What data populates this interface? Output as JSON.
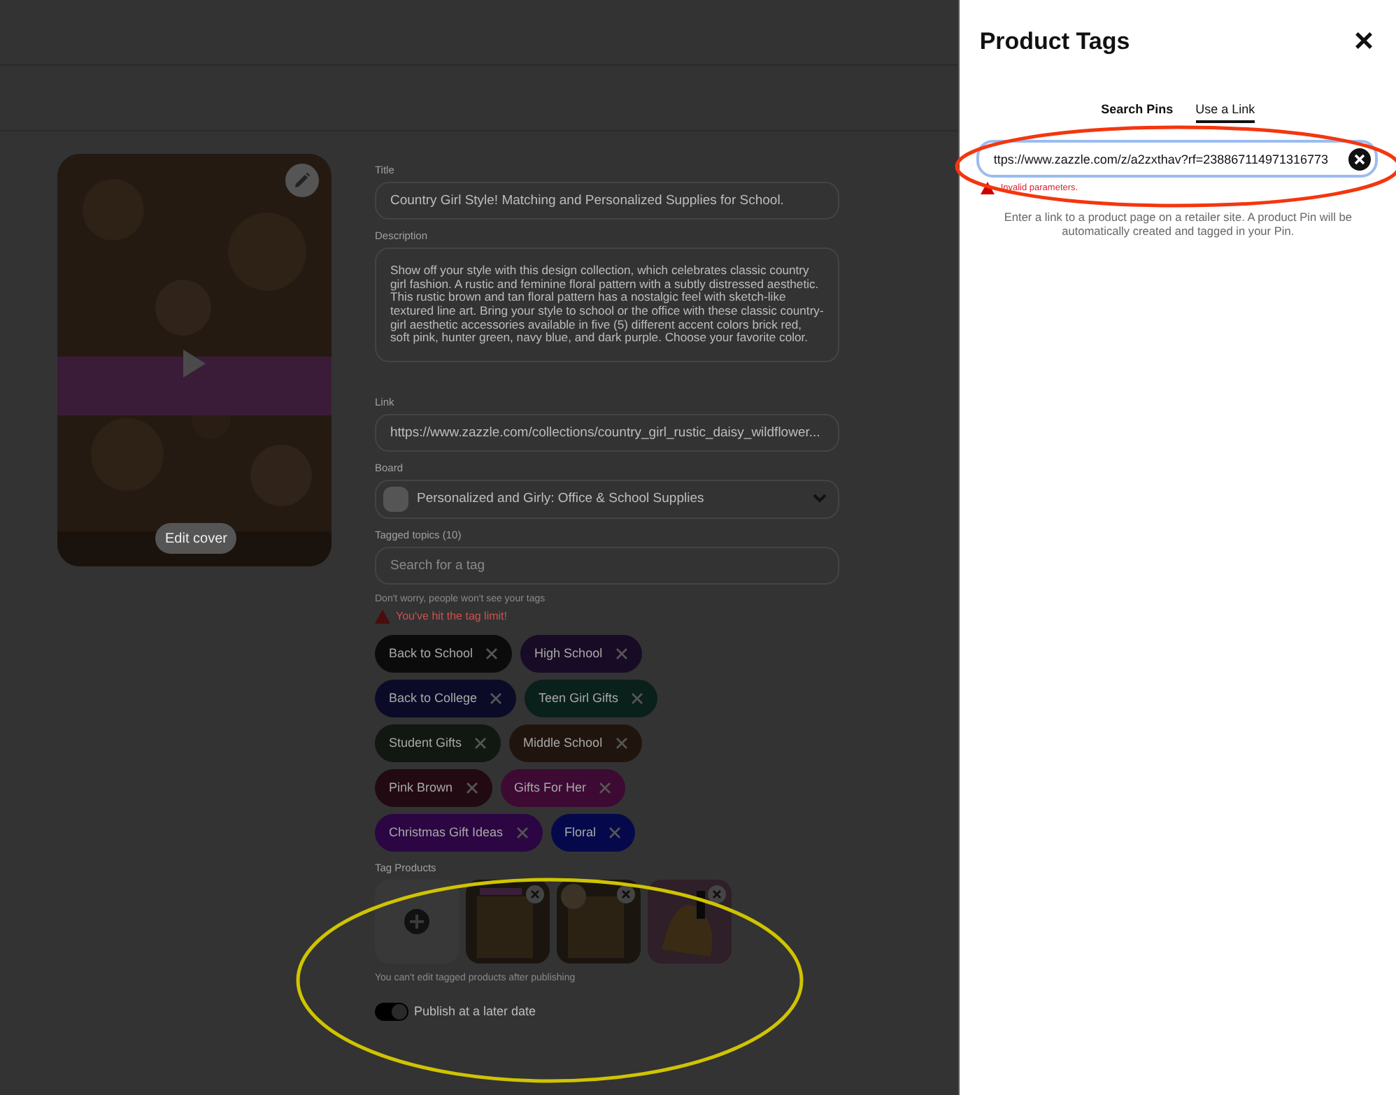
{
  "pin_form": {
    "cover": {
      "kind": "picture",
      "edit_label": "Edit cover"
    },
    "title": {
      "label": "Title",
      "value": "Country Girl Style! Matching and Personalized Supplies for School."
    },
    "description": {
      "label": "Description",
      "value": "Show off your style with this design collection, which celebrates classic country girl fashion. A rustic and feminine floral pattern with a subtly distressed aesthetic. This rustic brown and tan floral pattern has a nostalgic feel with sketch-like textured line art. Bring your style to school or the office with these classic country-girl aesthetic accessories available in five (5) different accent colors brick red, soft pink, hunter green, navy blue, and dark purple. Choose your favorite color."
    },
    "link": {
      "label": "Link",
      "value": "https://www.zazzle.com/collections/country_girl_rustic_daisy_wildflower..."
    },
    "board": {
      "label": "Board",
      "value": "Personalized and Girly: Office & School Supplies"
    },
    "topics": {
      "label": "Tagged topics (10)",
      "placeholder": "Search for a tag",
      "hint": "Don't worry, people won't see your tags",
      "error": "You've hit the tag limit!",
      "tags": [
        {
          "label": "Back to School",
          "color": "#0b0b0b"
        },
        {
          "label": "High School",
          "color": "#170b26"
        },
        {
          "label": "Back to College",
          "color": "#0b0b28"
        },
        {
          "label": "Teen Girl Gifts",
          "color": "#0a201b"
        },
        {
          "label": "Student Gifts",
          "color": "#111711"
        },
        {
          "label": "Middle School",
          "color": "#20150e"
        },
        {
          "label": "Pink Brown",
          "color": "#220a12"
        },
        {
          "label": "Gifts For Her",
          "color": "#3c0a32"
        },
        {
          "label": "Christmas Gift Ideas",
          "color": "#2b0642"
        },
        {
          "label": "Floral",
          "color": "#05094c"
        }
      ]
    },
    "products": {
      "label": "Tag Products",
      "note": "You can't edit tagged products after publishing"
    },
    "schedule": {
      "label": "Publish at a later date",
      "on": true
    }
  },
  "panel": {
    "title": "Product Tags",
    "close": "×",
    "tabs": [
      {
        "label": "Search Pins",
        "selected": false
      },
      {
        "label": "Use a Link",
        "selected": true
      }
    ],
    "link_field": {
      "value": "ttps://www.zazzle.com/z/a2zxthav?rf=238867114971316773",
      "error": "Invalid parameters."
    },
    "help": "Enter a link to a product page on a retailer site. A product Pin will be automatically created and tagged in your Pin."
  }
}
